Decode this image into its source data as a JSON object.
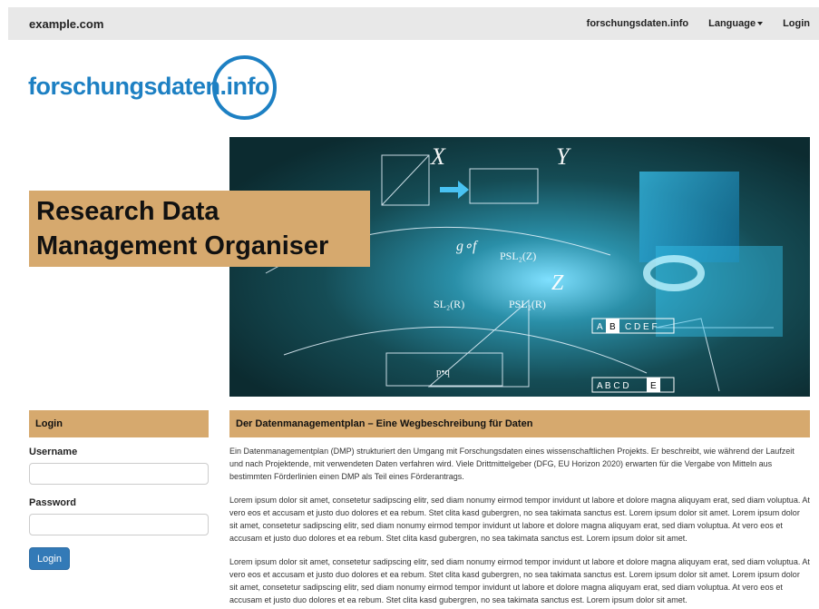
{
  "navbar": {
    "brand": "example.com",
    "links": [
      "forschungsdaten.info",
      "Language",
      "Login"
    ]
  },
  "logo": {
    "text": "forschungsdaten.info",
    "color": "#1d80c3"
  },
  "hero": {
    "title_line1": "Research Data",
    "title_line2": "Management Organiser",
    "accent": "#d6a96e"
  },
  "login": {
    "heading": "Login",
    "username_label": "Username",
    "password_label": "Password",
    "button": "Login"
  },
  "content": {
    "heading": "Der Datenmanagementplan – Eine Wegbeschreibung für Daten",
    "paragraphs": [
      "Ein Datenmanagementplan (DMP) strukturiert den Umgang mit Forschungsdaten eines wissenschaftlichen Projekts. Er beschreibt, wie während der Laufzeit und nach Projektende, mit verwendeten Daten verfahren wird. Viele Drittmittelgeber (DFG, EU Horizon 2020) erwarten für die Vergabe von Mitteln aus bestimmten Förderlinien einen DMP als Teil eines Förderantrags.",
      "Lorem ipsum dolor sit amet, consetetur sadipscing elitr, sed diam nonumy eirmod tempor invidunt ut labore et dolore magna aliquyam erat, sed diam voluptua. At vero eos et accusam et justo duo dolores et ea rebum. Stet clita kasd gubergren, no sea takimata sanctus est. Lorem ipsum dolor sit amet. Lorem ipsum dolor sit amet, consetetur sadipscing elitr, sed diam nonumy eirmod tempor invidunt ut labore et dolore magna aliquyam erat, sed diam voluptua. At vero eos et accusam et justo duo dolores et ea rebum. Stet clita kasd gubergren, no sea takimata sanctus est. Lorem ipsum dolor sit amet.",
      "Lorem ipsum dolor sit amet, consetetur sadipscing elitr, sed diam nonumy eirmod tempor invidunt ut labore et dolore magna aliquyam erat, sed diam voluptua. At vero eos et accusam et justo duo dolores et ea rebum. Stet clita kasd gubergren, no sea takimata sanctus est. Lorem ipsum dolor sit amet. Lorem ipsum dolor sit amet, consetetur sadipscing elitr, sed diam nonumy eirmod tempor invidunt ut labore et dolore magna aliquyam erat, sed diam voluptua. At vero eos et accusam et justo duo dolores et ea rebum. Stet clita kasd gubergren, no sea takimata sanctus est. Lorem ipsum dolor sit amet."
    ]
  }
}
